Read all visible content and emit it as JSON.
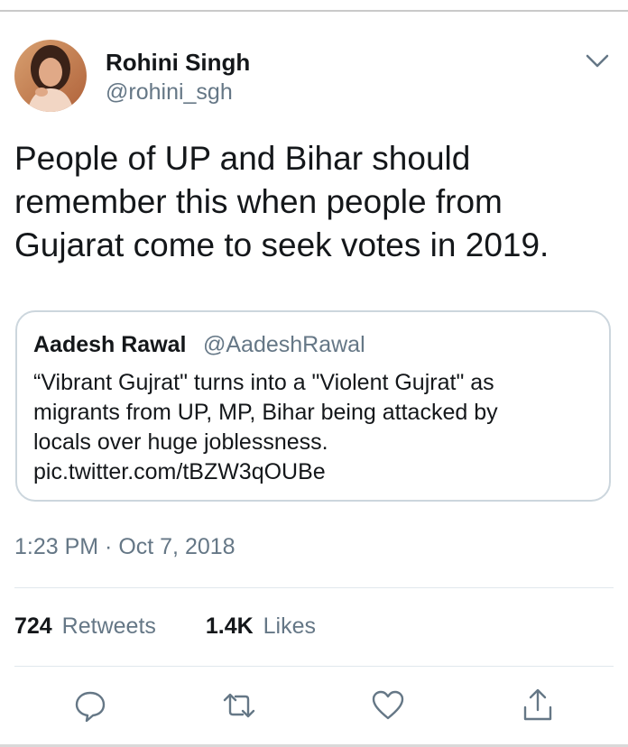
{
  "author": {
    "name": "Rohini Singh",
    "handle": "@rohini_sgh"
  },
  "tweet": {
    "text_lines": [
      "People of UP and Bihar should",
      "remember this when people from",
      "Gujarat come to seek votes in 2019."
    ]
  },
  "quoted": {
    "name": "Aadesh Rawal",
    "handle": "@AadeshRawal",
    "lines": [
      "“Vibrant Gujrat\" turns into a \"Violent Gujrat\" as",
      "migrants from UP, MP, Bihar being attacked by",
      "locals over huge joblessness.",
      "pic.twitter.com/tBZW3qOUBe"
    ]
  },
  "timestamp": "1:23 PM · Oct 7, 2018",
  "stats": {
    "retweets_count": "724",
    "retweets_label": "Retweets",
    "likes_count": "1.4K",
    "likes_label": "Likes"
  },
  "icons": {
    "menu": "chevron-down-icon",
    "reply": "reply-icon",
    "retweet": "retweet-icon",
    "like": "heart-icon",
    "share": "share-icon"
  },
  "colors": {
    "text": "#14171a",
    "secondary": "#657786",
    "border": "#ccd6dd"
  }
}
